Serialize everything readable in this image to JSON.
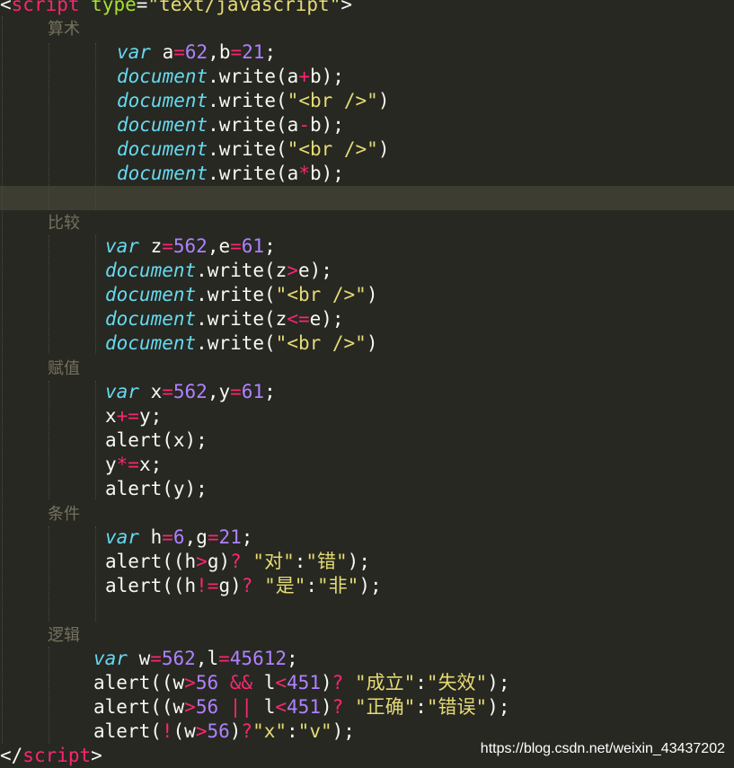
{
  "code": {
    "open_tag": {
      "lt": "<",
      "name": "script",
      "attr": "type",
      "eq": "=",
      "val": "\"text/javascript\"",
      "gt": ">"
    },
    "close_tag": {
      "lt": "</",
      "name": "script",
      "gt": ">"
    },
    "sections": {
      "s1": {
        "comment": "算术",
        "l1": {
          "kw": "var",
          "t1": " a",
          "op1": "=",
          "n1": "62",
          "t2": ",b",
          "op2": "=",
          "n2": "21",
          "t3": ";"
        },
        "l2": {
          "kw": "document",
          "t1": ".write(a",
          "op": "+",
          "t2": "b);"
        },
        "l3": {
          "kw": "document",
          "t1": ".write(",
          "str": "\"<br />\"",
          "t2": ")"
        },
        "l4": {
          "kw": "document",
          "t1": ".write(a",
          "op": "-",
          "t2": "b);"
        },
        "l5": {
          "kw": "document",
          "t1": ".write(",
          "str": "\"<br />\"",
          "t2": ")"
        },
        "l6": {
          "kw": "document",
          "t1": ".write(a",
          "op": "*",
          "t2": "b);"
        }
      },
      "s2": {
        "comment": "比较",
        "l1": {
          "kw": "var",
          "t1": " z",
          "op1": "=",
          "n1": "562",
          "t2": ",e",
          "op2": "=",
          "n2": "61",
          "t3": ";"
        },
        "l2": {
          "kw": "document",
          "t1": ".write(z",
          "op": ">",
          "t2": "e);"
        },
        "l3": {
          "kw": "document",
          "t1": ".write(",
          "str": "\"<br />\"",
          "t2": ")"
        },
        "l4": {
          "kw": "document",
          "t1": ".write(z",
          "op": "<=",
          "t2": "e);"
        },
        "l5": {
          "kw": "document",
          "t1": ".write(",
          "str": "\"<br />\"",
          "t2": ")"
        }
      },
      "s3": {
        "comment": "赋值",
        "l1": {
          "kw": "var",
          "t1": " x",
          "op1": "=",
          "n1": "562",
          "t2": ",y",
          "op2": "=",
          "n2": "61",
          "t3": ";"
        },
        "l2": {
          "t1": "x",
          "op": "+=",
          "t2": "y;"
        },
        "l3": {
          "t1": "alert(x);"
        },
        "l4": {
          "t1": "y",
          "op": "*=",
          "t2": "x;"
        },
        "l5": {
          "t1": "alert(y);"
        }
      },
      "s4": {
        "comment": "条件",
        "l1": {
          "kw": "var",
          "t1": " h",
          "op1": "=",
          "n1": "6",
          "t2": ",g",
          "op2": "=",
          "n2": "21",
          "t3": ";"
        },
        "l2": {
          "t1": "alert((h",
          "op1": ">",
          "t2": "g)",
          "op2": "?",
          "sp": " ",
          "s1": "\"对\"",
          "t3": ":",
          "s2": "\"错\"",
          "t4": ");"
        },
        "l3": {
          "t1": "alert((h",
          "op1": "!=",
          "t2": "g)",
          "op2": "?",
          "sp": " ",
          "s1": "\"是\"",
          "t3": ":",
          "s2": "\"非\"",
          "t4": ");"
        }
      },
      "s5": {
        "comment": "逻辑",
        "l1": {
          "kw": "var",
          "t1": " w",
          "op1": "=",
          "n1": "562",
          "t2": ",l",
          "op2": "=",
          "n2": "45612",
          "t3": ";"
        },
        "l2": {
          "t1": "alert((w",
          "op1": ">",
          "n1": "56",
          "sp1": " ",
          "op2": "&&",
          "sp2": " ",
          "t2": "l",
          "op3": "<",
          "n2": "451",
          "t3": ")",
          "op4": "?",
          "sp3": " ",
          "s1": "\"成立\"",
          "t4": ":",
          "s2": "\"失效\"",
          "t5": ");"
        },
        "l3": {
          "t1": "alert((w",
          "op1": ">",
          "n1": "56",
          "sp1": " ",
          "op2": "||",
          "sp2": " ",
          "t2": "l",
          "op3": "<",
          "n2": "451",
          "t3": ")",
          "op4": "?",
          "sp3": " ",
          "s1": "\"正确\"",
          "t4": ":",
          "s2": "\"错误\"",
          "t5": ");"
        },
        "l4": {
          "t1": "alert(",
          "op1": "!",
          "t2": "(w",
          "op2": ">",
          "n1": "56",
          "t3": ")",
          "op3": "?",
          "s1": "\"x\"",
          "t4": ":",
          "s2": "\"v\"",
          "t5": ");"
        }
      }
    }
  },
  "watermark": "https://blog.csdn.net/weixin_43437202",
  "colors": {
    "background": "#272822",
    "keyword": "#66d9ef",
    "operator": "#f92672",
    "number": "#ae81ff",
    "string": "#e6db74",
    "comment": "#75715e"
  }
}
